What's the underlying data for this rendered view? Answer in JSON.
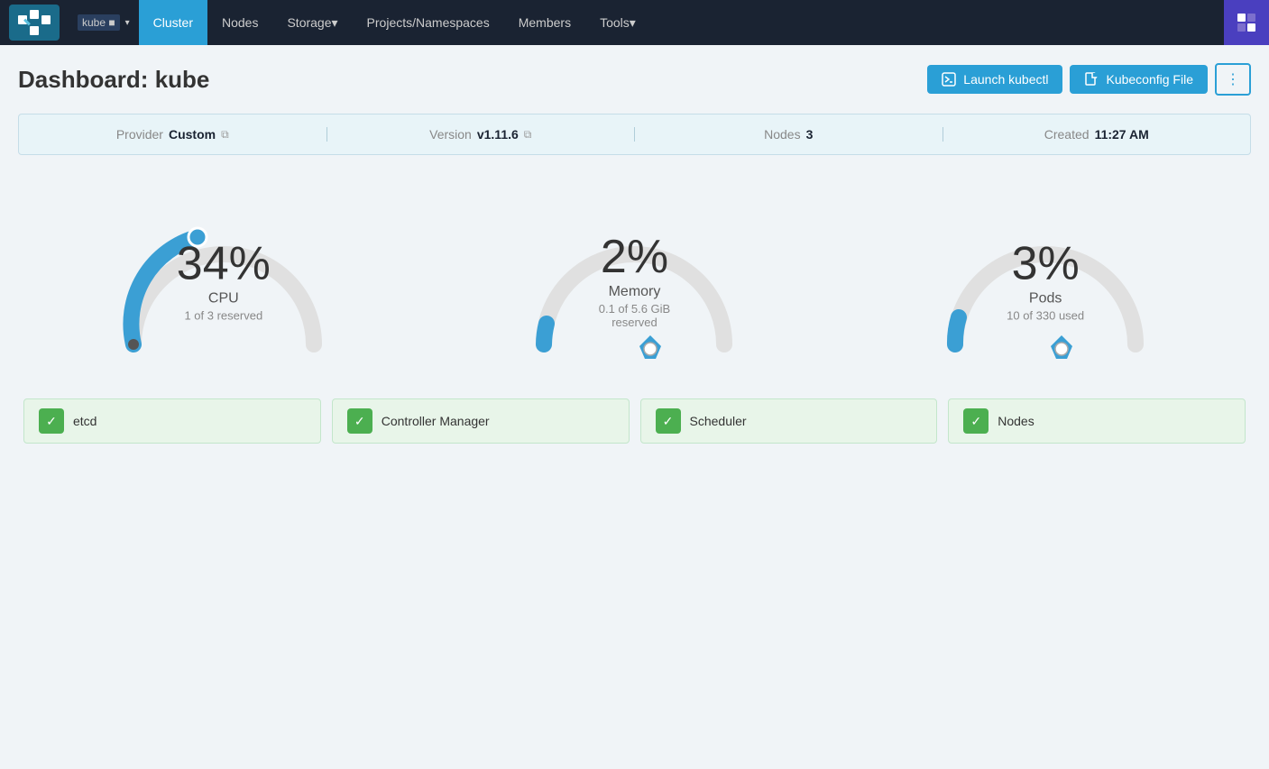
{
  "navbar": {
    "logo_alt": "Rancher Logo",
    "cluster_name": "kube",
    "cluster_icon": "■",
    "nav_items": [
      {
        "label": "Cluster",
        "active": true
      },
      {
        "label": "Nodes",
        "active": false
      },
      {
        "label": "Storage",
        "active": false,
        "has_dropdown": true
      },
      {
        "label": "Projects/Namespaces",
        "active": false
      },
      {
        "label": "Members",
        "active": false
      },
      {
        "label": "Tools",
        "active": false,
        "has_dropdown": true
      }
    ]
  },
  "header": {
    "title_prefix": "Dashboard:",
    "title_name": "kube",
    "btn_launch_kubectl": "Launch kubectl",
    "btn_kubeconfig": "Kubeconfig File",
    "btn_dots": "⋮"
  },
  "info_bar": {
    "provider_label": "Provider",
    "provider_value": "Custom",
    "version_label": "Version",
    "version_value": "v1.11.6",
    "nodes_label": "Nodes",
    "nodes_value": "3",
    "created_label": "Created",
    "created_value": "11:27 AM"
  },
  "gauges": [
    {
      "id": "cpu",
      "percent": "34%",
      "label": "CPU",
      "sub": "1 of 3 reserved",
      "value": 34,
      "color": "#3b9fd4"
    },
    {
      "id": "memory",
      "percent": "2%",
      "label": "Memory",
      "sub": "0.1 of 5.6 GiB reserved",
      "value": 2,
      "color": "#3b9fd4"
    },
    {
      "id": "pods",
      "percent": "3%",
      "label": "Pods",
      "sub": "10 of 330 used",
      "value": 3,
      "color": "#3b9fd4"
    }
  ],
  "status_items": [
    {
      "label": "etcd"
    },
    {
      "label": "Controller Manager"
    },
    {
      "label": "Scheduler"
    },
    {
      "label": "Nodes"
    }
  ]
}
